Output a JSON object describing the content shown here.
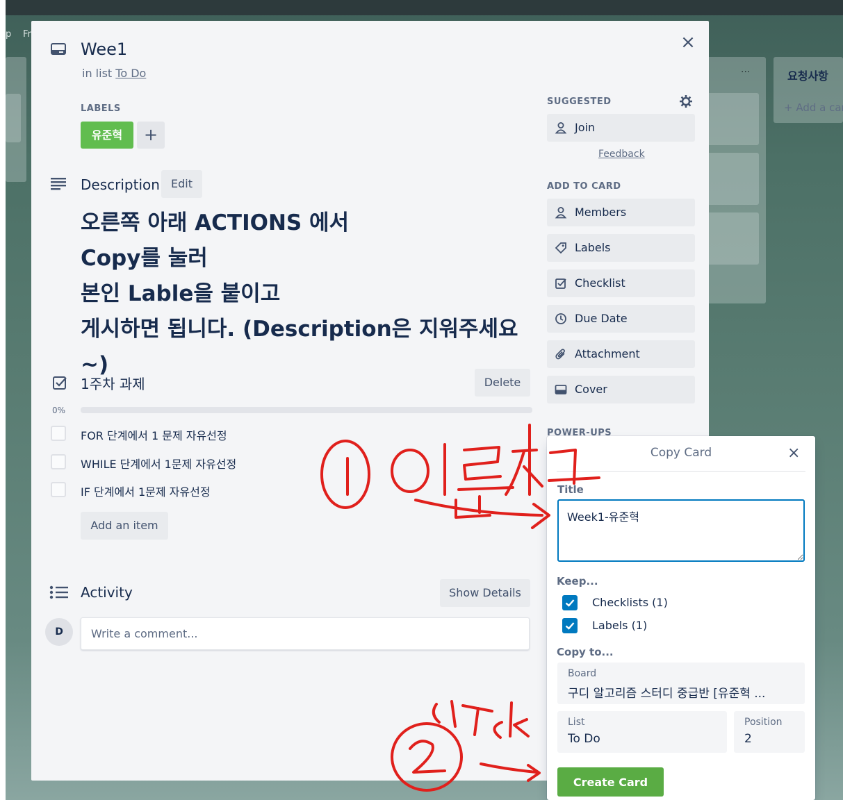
{
  "background": {
    "crumbs": [
      "p",
      "Fr"
    ],
    "list_title": "요청사항",
    "add_card_label": "+ Add a card",
    "list_menu": "···"
  },
  "card": {
    "title": "Wee1",
    "in_list_prefix": "in list",
    "list_name": "To Do",
    "close_label": "×"
  },
  "labels": {
    "heading": "LABELS",
    "items": [
      {
        "text": "유준혁",
        "color": "#61bd4f"
      }
    ],
    "add_label": "+"
  },
  "description": {
    "heading": "Description",
    "edit_label": "Edit",
    "lines": [
      "오른쪽 아래 ACTIONS 에서",
      "Copy를 눌러",
      "본인 Lable을 붙이고",
      "게시하면 됩니다. (Description은 지워주세요~)"
    ]
  },
  "checklist": {
    "title": "1주차 과제",
    "delete_label": "Delete",
    "percent_label": "0%",
    "progress": 0,
    "items": [
      {
        "text": "FOR 단계에서 1 문제 자유선정",
        "checked": false
      },
      {
        "text": "WHILE 단계에서 1문제 자유선정",
        "checked": false
      },
      {
        "text": "IF 단계에서 1문제 자유선정",
        "checked": false
      }
    ],
    "add_item_label": "Add an item"
  },
  "activity": {
    "title": "Activity",
    "show_details_label": "Show Details",
    "avatar_initial": "D",
    "comment_placeholder": "Write a comment..."
  },
  "sidebar": {
    "suggested_heading": "SUGGESTED",
    "join_label": "Join",
    "feedback_label": "Feedback",
    "add_to_card_heading": "ADD TO CARD",
    "items": [
      {
        "label": "Members",
        "icon": "person-icon"
      },
      {
        "label": "Labels",
        "icon": "tag-icon"
      },
      {
        "label": "Checklist",
        "icon": "checklist-icon"
      },
      {
        "label": "Due Date",
        "icon": "clock-icon"
      },
      {
        "label": "Attachment",
        "icon": "paperclip-icon"
      },
      {
        "label": "Cover",
        "icon": "cover-icon"
      }
    ],
    "power_ups_heading": "POWER-UPS"
  },
  "copy_card": {
    "title": "Copy Card",
    "close_label": "×",
    "title_label": "Title",
    "title_value": "Week1-유준혁",
    "keep_label": "Keep...",
    "keep_items": [
      {
        "text": "Checklists (1)",
        "checked": true
      },
      {
        "text": "Labels (1)",
        "checked": true
      }
    ],
    "copy_to_label": "Copy to...",
    "board_label": "Board",
    "board_value": "구디 알고리즘 스터디 중급반 [유준혁 ...",
    "list_label": "List",
    "list_value": "To Do",
    "position_label": "Position",
    "position_value": "2",
    "create_label": "Create Card",
    "accent_color": "#0079bf",
    "button_color": "#5aac44"
  },
  "annotations": {
    "step1_text": "① 이름적고",
    "step2_text": "② click",
    "ink_color": "#e0201c"
  }
}
